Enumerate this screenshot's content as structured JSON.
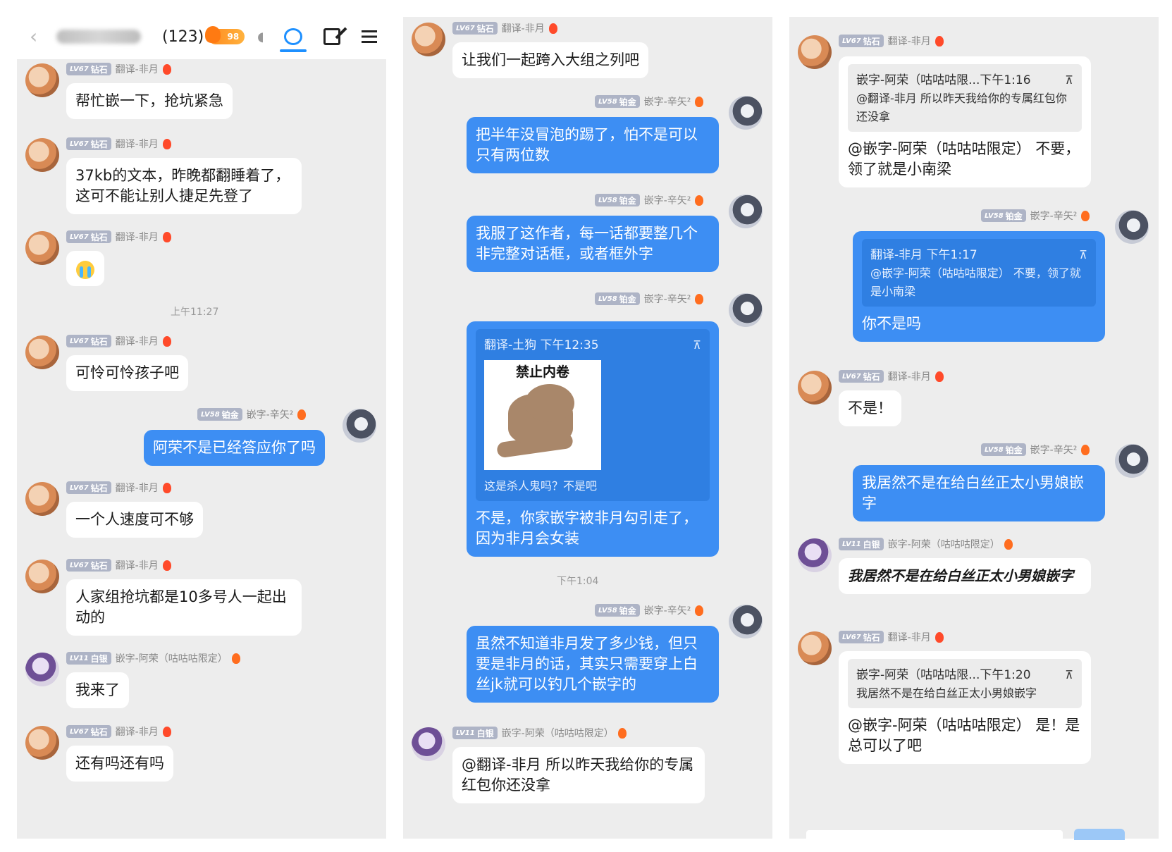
{
  "header": {
    "count": "(123)",
    "fire_level": "98"
  },
  "users": {
    "feiyue": {
      "level": "LV67",
      "rank": "钻石",
      "name": "翻译-非月"
    },
    "xinshi": {
      "level": "LV58",
      "rank": "铂金",
      "name": "嵌字-辛矢²"
    },
    "arong": {
      "level": "LV11",
      "rank": "白银",
      "name": "嵌字-阿荣（咕咕咕限定）"
    }
  },
  "panel1": {
    "m1": "帮忙嵌一下，抢坑紧急",
    "m2": "37kb的文本，昨晚都翻睡着了，这可不能让别人捷足先登了",
    "time1": "上午11:27",
    "m4": "可怜可怜孩子吧",
    "m5": "阿荣不是已经答应你了吗",
    "m6": "一个人速度可不够",
    "m7": "人家组抢坑都是10多号人一起出动的",
    "m8": "我来了",
    "m9": "还有吗还有吗"
  },
  "panel2": {
    "m1": "让我们一起跨入大组之列吧",
    "m2": "把半年没冒泡的踢了，怕不是可以只有两位数",
    "m3": "我服了这作者，每一话都要整几个非完整对话框，或者框外字",
    "quote_head": "翻译-土狗 下午12:35",
    "quote_pin": "⊼",
    "sticker_title": "禁止内卷",
    "quote_caption": "这是杀人鬼吗？不是吧",
    "m4": "不是，你家嵌字被非月勾引走了，因为非月会女装",
    "time1": "下午1:04",
    "m5": "虽然不知道非月发了多少钱，但只要是非月的话，其实只需要穿上白丝jk就可以钓几个嵌字的",
    "m6": "@翻译-非月 所以昨天我给你的专属红包你还没拿"
  },
  "panel3": {
    "q1_head": "嵌字-阿荣（咕咕咕限...下午1:16",
    "q1_body": "@翻译-非月 所以昨天我给你的专属红包你还没拿",
    "m1": "@嵌字-阿荣（咕咕咕限定） 不要，领了就是小南梁",
    "q2_head": "翻译-非月 下午1:17",
    "q2_body": "@嵌字-阿荣（咕咕咕限定） 不要，领了就是小南梁",
    "m2": "你不是吗",
    "m3": "不是！",
    "m4": "我居然不是在给白丝正太小男娘嵌字",
    "m5": "我居然不是在给白丝正太小男娘嵌字",
    "q3_head": "嵌字-阿荣（咕咕咕限...下午1:20",
    "q3_body": "我居然不是在给白丝正太小男娘嵌字",
    "m6": "@嵌字-阿荣（咕咕咕限定） 是！是总可以了吧"
  }
}
